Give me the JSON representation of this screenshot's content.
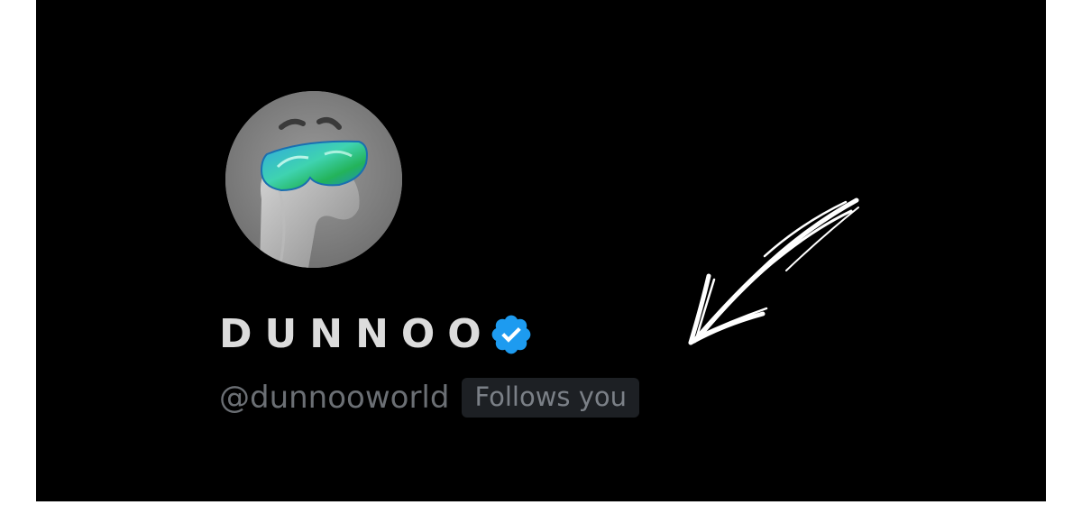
{
  "profile": {
    "display_name": "Dunnoo",
    "handle": "@dunnooworld",
    "follows_badge": "Follows you",
    "verified": true,
    "verified_badge_color": "#1d9bf0"
  },
  "colors": {
    "background": "#000000",
    "display_name": "#dcdcdc",
    "handle": "#6b6f74",
    "badge_bg": "#1d2024",
    "badge_text": "#7b8087",
    "arrow": "#ffffff"
  },
  "icons": {
    "avatar": "cartoon-character-with-goggles",
    "verified": "verified-badge-icon",
    "annotation": "hand-drawn-arrow-icon"
  }
}
